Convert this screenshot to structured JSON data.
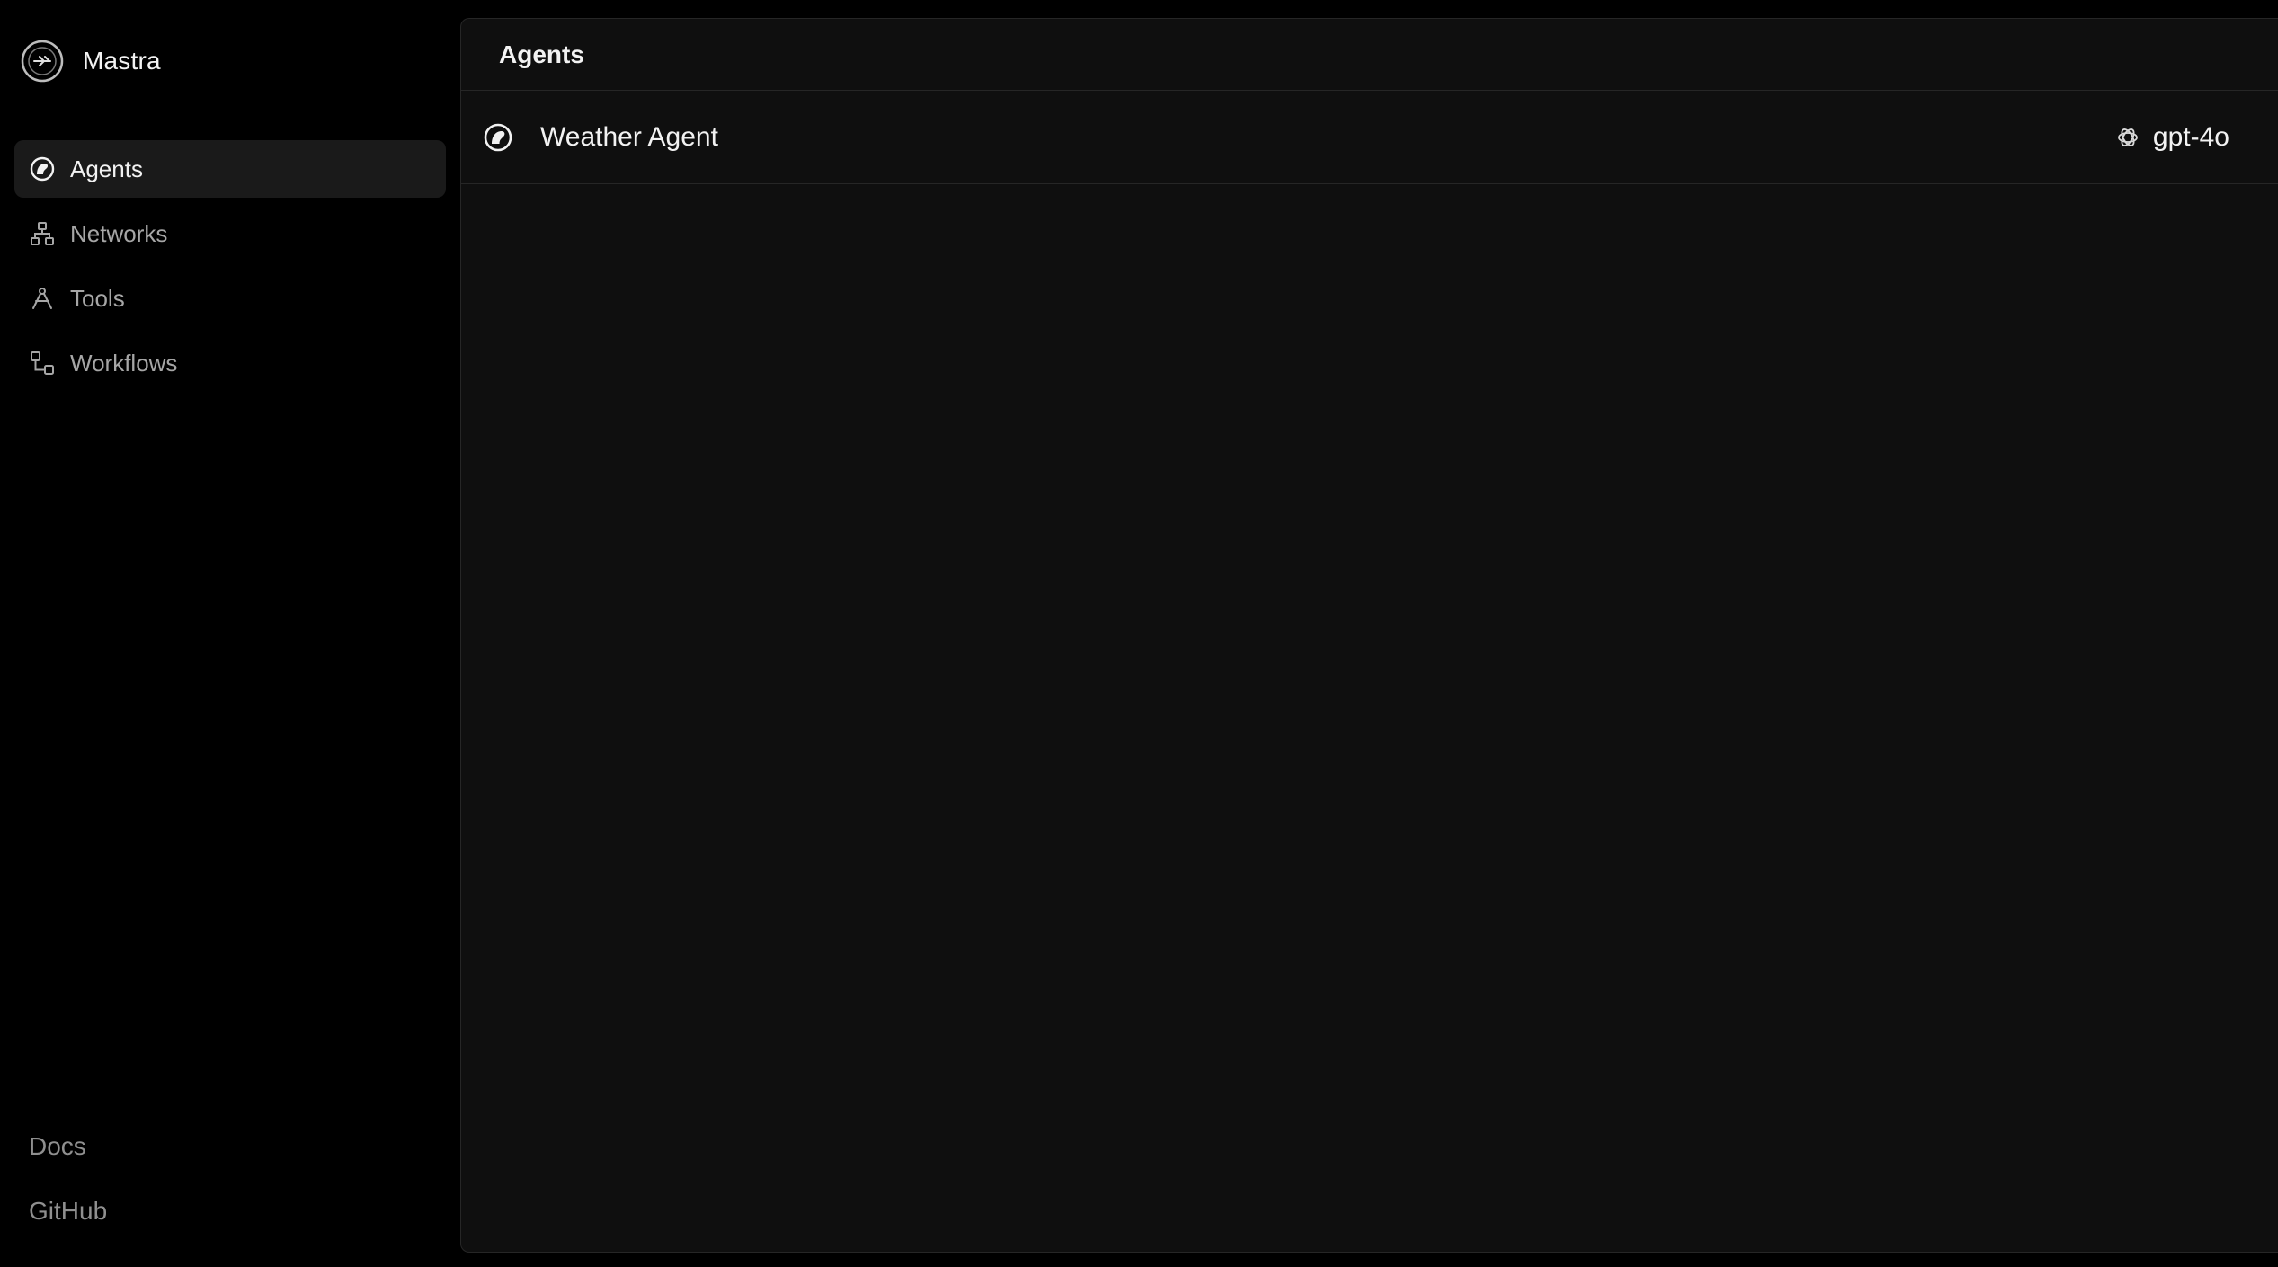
{
  "brand": {
    "name": "Mastra",
    "logo_icon": "mastra-logo-icon"
  },
  "sidebar": {
    "items": [
      {
        "label": "Agents",
        "icon": "agent-icon",
        "active": true
      },
      {
        "label": "Networks",
        "icon": "network-icon",
        "active": false
      },
      {
        "label": "Tools",
        "icon": "tool-icon",
        "active": false
      },
      {
        "label": "Workflows",
        "icon": "workflow-icon",
        "active": false
      }
    ],
    "footer": [
      {
        "label": "Docs"
      },
      {
        "label": "GitHub"
      }
    ]
  },
  "main": {
    "title": "Agents",
    "agents": [
      {
        "name": "Weather Agent",
        "icon": "agent-icon",
        "model": "gpt-4o",
        "model_icon": "openai-icon"
      }
    ]
  },
  "colors": {
    "background": "#000000",
    "panel": "#0f0f0f",
    "active_item": "#1a1a1a",
    "border": "#262626",
    "text_primary": "#f2f2f2",
    "text_muted": "#a6a6a6"
  }
}
